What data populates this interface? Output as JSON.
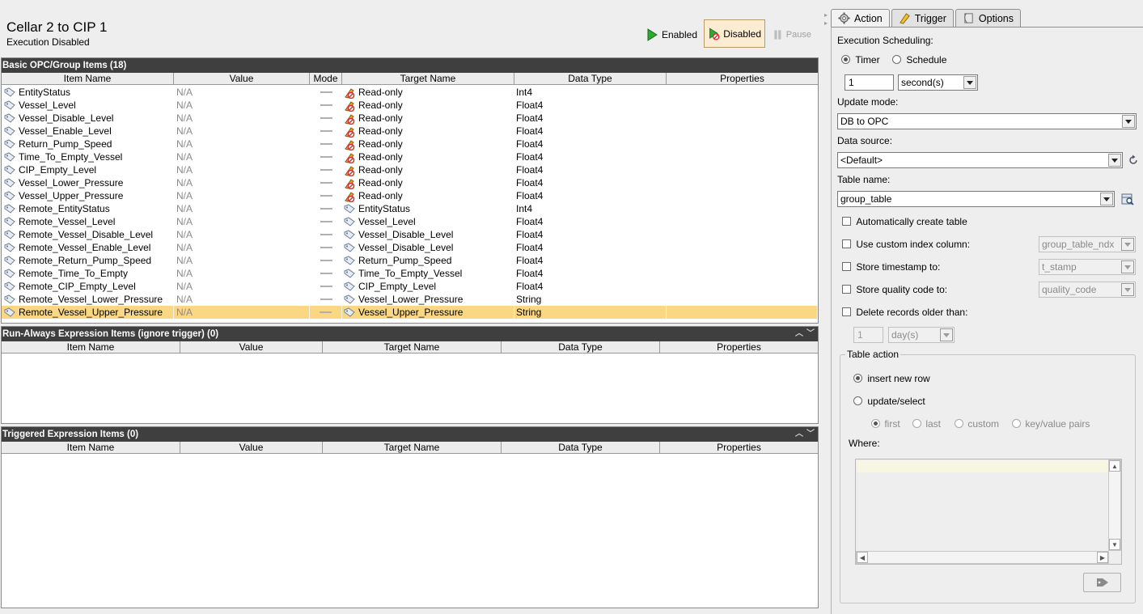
{
  "header": {
    "title": "Cellar 2 to CIP 1",
    "subtitle": "Execution Disabled",
    "enabled_label": "Enabled",
    "disabled_label": "Disabled",
    "pause_label": "Pause"
  },
  "opc_panel": {
    "title": "Basic OPC/Group Items (18)",
    "columns": [
      "Item Name",
      "Value",
      "Mode",
      "Target Name",
      "Data Type",
      "Properties"
    ],
    "rows": [
      {
        "name": "EntityStatus",
        "value": "N/A",
        "target": "Read-only",
        "target_icon": "read-only-icon",
        "type": "Int4"
      },
      {
        "name": "Vessel_Level",
        "value": "N/A",
        "target": "Read-only",
        "target_icon": "read-only-icon",
        "type": "Float4"
      },
      {
        "name": "Vessel_Disable_Level",
        "value": "N/A",
        "target": "Read-only",
        "target_icon": "read-only-icon",
        "type": "Float4"
      },
      {
        "name": "Vessel_Enable_Level",
        "value": "N/A",
        "target": "Read-only",
        "target_icon": "read-only-icon",
        "type": "Float4"
      },
      {
        "name": "Return_Pump_Speed",
        "value": "N/A",
        "target": "Read-only",
        "target_icon": "read-only-icon",
        "type": "Float4"
      },
      {
        "name": "Time_To_Empty_Vessel",
        "value": "N/A",
        "target": "Read-only",
        "target_icon": "read-only-icon",
        "type": "Float4"
      },
      {
        "name": "CIP_Empty_Level",
        "value": "N/A",
        "target": "Read-only",
        "target_icon": "read-only-icon",
        "type": "Float4"
      },
      {
        "name": "Vessel_Lower_Pressure",
        "value": "N/A",
        "target": "Read-only",
        "target_icon": "read-only-icon",
        "type": "Float4"
      },
      {
        "name": "Vessel_Upper_Pressure",
        "value": "N/A",
        "target": "Read-only",
        "target_icon": "read-only-icon",
        "type": "Float4"
      },
      {
        "name": "Remote_EntityStatus",
        "value": "N/A",
        "target": "EntityStatus",
        "target_icon": "tag-icon",
        "type": "Int4"
      },
      {
        "name": "Remote_Vessel_Level",
        "value": "N/A",
        "target": "Vessel_Level",
        "target_icon": "tag-icon",
        "type": "Float4"
      },
      {
        "name": "Remote_Vessel_Disable_Level",
        "value": "N/A",
        "target": "Vessel_Disable_Level",
        "target_icon": "tag-icon",
        "type": "Float4"
      },
      {
        "name": "Remote_Vessel_Enable_Level",
        "value": "N/A",
        "target": "Vessel_Disable_Level",
        "target_icon": "tag-icon",
        "type": "Float4"
      },
      {
        "name": "Remote_Return_Pump_Speed",
        "value": "N/A",
        "target": "Return_Pump_Speed",
        "target_icon": "tag-icon",
        "type": "Float4"
      },
      {
        "name": "Remote_Time_To_Empty",
        "value": "N/A",
        "target": "Time_To_Empty_Vessel",
        "target_icon": "tag-icon",
        "type": "Float4"
      },
      {
        "name": "Remote_CIP_Empty_Level",
        "value": "N/A",
        "target": "CIP_Empty_Level",
        "target_icon": "tag-icon",
        "type": "Float4"
      },
      {
        "name": "Remote_Vessel_Lower_Pressure",
        "value": "N/A",
        "target": "Vessel_Lower_Pressure",
        "target_icon": "tag-icon",
        "type": "String"
      },
      {
        "name": "Remote_Vessel_Upper_Pressure",
        "value": "N/A",
        "target": "Vessel_Upper_Pressure",
        "target_icon": "tag-icon",
        "type": "String",
        "selected": true
      }
    ]
  },
  "run_always_panel": {
    "title": "Run-Always Expression Items (ignore trigger) (0)",
    "columns": [
      "Item Name",
      "Value",
      "Target Name",
      "Data Type",
      "Properties"
    ]
  },
  "triggered_panel": {
    "title": "Triggered Expression Items (0)",
    "columns": [
      "Item Name",
      "Value",
      "Target Name",
      "Data Type",
      "Properties"
    ]
  },
  "tabs": [
    {
      "label": "Action",
      "icon": "gear-icon",
      "active": true
    },
    {
      "label": "Trigger",
      "icon": "trigger-icon",
      "active": false
    },
    {
      "label": "Options",
      "icon": "options-icon",
      "active": false
    }
  ],
  "action": {
    "scheduling_label": "Execution Scheduling:",
    "timer_label": "Timer",
    "schedule_label": "Schedule",
    "timer_value": "1",
    "timer_unit": "second(s)",
    "update_mode_label": "Update mode:",
    "update_mode_value": "DB to OPC",
    "data_source_label": "Data source:",
    "data_source_value": "<Default>",
    "table_name_label": "Table name:",
    "table_name_value": "group_table",
    "auto_create_label": "Automatically create table",
    "custom_index_label": "Use custom index column:",
    "custom_index_value": "group_table_ndx",
    "timestamp_label": "Store timestamp to:",
    "timestamp_value": "t_stamp",
    "quality_label": "Store quality code to:",
    "quality_value": "quality_code",
    "delete_label": "Delete records older than:",
    "delete_value": "1",
    "delete_unit": "day(s)",
    "table_action_label": "Table action",
    "insert_label": "insert new row",
    "update_label": "update/select",
    "first_label": "first",
    "last_label": "last",
    "custom_label": "custom",
    "keyvalue_label": "key/value pairs",
    "where_label": "Where:"
  }
}
